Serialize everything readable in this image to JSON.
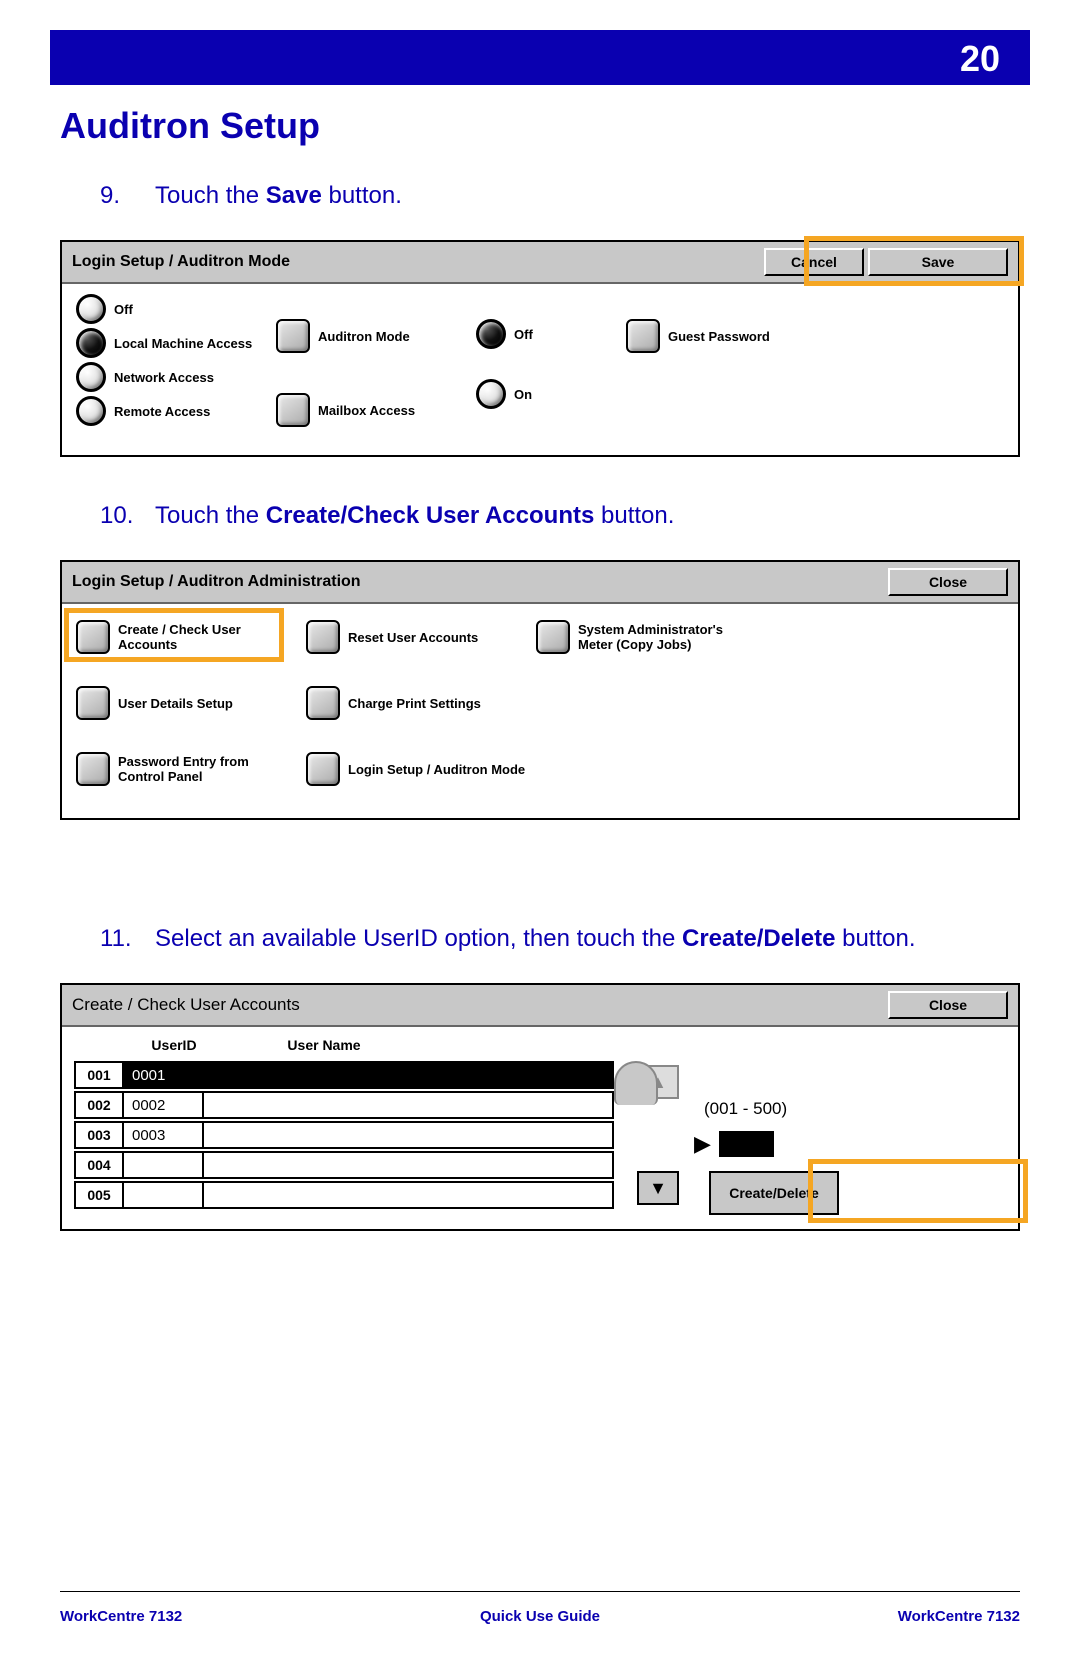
{
  "page_number": "20",
  "title": "Auditron Setup",
  "steps": {
    "s9": {
      "num": "9.",
      "pre": "Touch the ",
      "bold": "Save",
      "post": " button."
    },
    "s10": {
      "num": "10.",
      "pre": "Touch the ",
      "bold": "Create/Check User Accounts",
      "post": " button."
    },
    "s11": {
      "num": "11.",
      "pre": "Select an available UserID option, then touch the ",
      "bold": "Create/Delete",
      "post": " button."
    }
  },
  "panel1": {
    "title": "Login Setup / Auditron Mode",
    "cancel": "Cancel",
    "save": "Save",
    "radios": {
      "off": "Off",
      "local": "Local Machine Access",
      "network": "Network Access",
      "remote": "Remote Access"
    },
    "col2": {
      "auditron_mode": "Auditron Mode",
      "mailbox_access": "Mailbox Access"
    },
    "col3": {
      "off": "Off",
      "on": "On"
    },
    "col4": {
      "guest_password": "Guest Password"
    }
  },
  "panel2": {
    "title": "Login Setup / Auditron Administration",
    "close": "Close",
    "items": {
      "create_check": "Create / Check User Accounts",
      "reset": "Reset User Accounts",
      "sys_admin_meter": "System Administrator's Meter (Copy Jobs)",
      "user_details": "User Details Setup",
      "charge_print": "Charge Print Settings",
      "pw_entry": "Password Entry from Control Panel",
      "login_mode": "Login Setup / Auditron Mode"
    }
  },
  "panel3": {
    "title": "Create / Check User Accounts",
    "close": "Close",
    "col_userid": "UserID",
    "col_username": "User Name",
    "rows": [
      {
        "idx": "001",
        "uid": "0001",
        "name": ""
      },
      {
        "idx": "002",
        "uid": "0002",
        "name": ""
      },
      {
        "idx": "003",
        "uid": "0003",
        "name": ""
      },
      {
        "idx": "004",
        "uid": "",
        "name": ""
      },
      {
        "idx": "005",
        "uid": "",
        "name": ""
      }
    ],
    "range": "(001 - 500)",
    "create_delete": "Create/Delete"
  },
  "footer": {
    "left": "WorkCentre 7132",
    "center": "Quick Use Guide",
    "right": "WorkCentre 7132"
  }
}
